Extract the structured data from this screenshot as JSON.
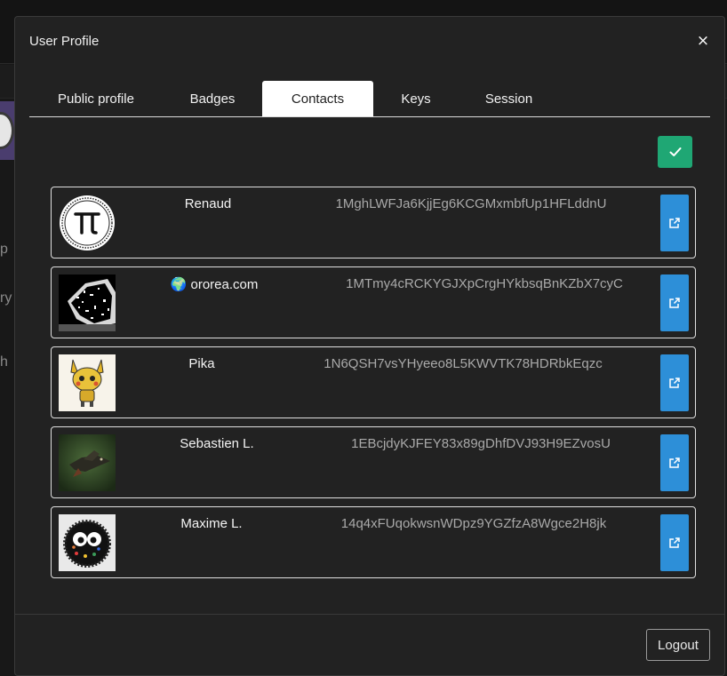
{
  "background": {
    "fragments": [
      "p",
      "ry",
      "h"
    ]
  },
  "modal": {
    "title": "User Profile",
    "close_label": "×"
  },
  "tabs": [
    {
      "label": "Public profile",
      "active": false
    },
    {
      "label": "Badges",
      "active": false
    },
    {
      "label": "Contacts",
      "active": true
    },
    {
      "label": "Keys",
      "active": false
    },
    {
      "label": "Session",
      "active": false
    }
  ],
  "contacts": [
    {
      "name": "Renaud",
      "address": "1MghLWFJa6KjjEg6KCGMxmbfUp1HFLddnU",
      "avatar": "pi-icon"
    },
    {
      "name": "🌍 ororea.com",
      "address": "1MTmy4cRCKYGJXpCrgHYkbsqBnKZbX7cyC",
      "avatar": "noise-image"
    },
    {
      "name": "Pika",
      "address": "1N6QSH7vsYHyeeo8L5KWVTK78HDRbkEqzc",
      "avatar": "pikachu-drawing"
    },
    {
      "name": "Sebastien L.",
      "address": "1EBcjdyKJFEY83x89gDhfDVJ93H9EZvosU",
      "avatar": "bird-photo"
    },
    {
      "name": "Maxime L.",
      "address": "14q4xFUqokwsnWDpz9YGZfzA8Wgce2H8jk",
      "avatar": "fuzzy-creature"
    }
  ],
  "footer": {
    "logout_label": "Logout"
  },
  "colors": {
    "confirm": "#1fa774",
    "open": "#2d8fd8",
    "panel": "#222222"
  }
}
